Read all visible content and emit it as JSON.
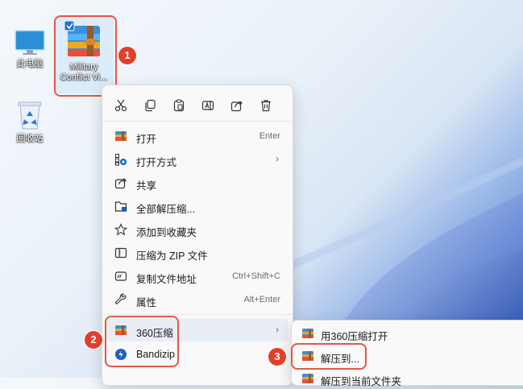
{
  "desktop": {
    "icons": [
      {
        "label": "此电脑"
      },
      {
        "label_line1": "Military",
        "label_line2": "Conflict Vi..."
      },
      {
        "label": "回收站"
      }
    ]
  },
  "steps": [
    "1",
    "2",
    "3"
  ],
  "context_menu": {
    "toolbar": [
      "cut-icon",
      "copy-icon",
      "paste-icon",
      "rename-icon",
      "share-icon",
      "delete-icon"
    ],
    "items": [
      {
        "label": "打开",
        "accel": "Enter",
        "icon": "archive-icon"
      },
      {
        "label": "打开方式",
        "submenu": true,
        "icon": "open-with-icon"
      },
      {
        "label": "共享",
        "icon": "share-icon"
      },
      {
        "label": "全部解压缩...",
        "icon": "extract-all-icon"
      },
      {
        "label": "添加到收藏夹",
        "icon": "star-icon"
      },
      {
        "label": "压缩为 ZIP 文件",
        "icon": "zip-icon"
      },
      {
        "label": "复制文件地址",
        "accel": "Ctrl+Shift+C",
        "icon": "copy-path-icon"
      },
      {
        "label": "属性",
        "accel": "Alt+Enter",
        "icon": "wrench-icon"
      },
      {
        "label": "360压缩",
        "submenu": true,
        "icon": "archive-icon"
      },
      {
        "label": "Bandizip",
        "icon": "bandizip-icon"
      }
    ],
    "chevron": "›"
  },
  "submenu": {
    "items": [
      {
        "label": "用360压缩打开"
      },
      {
        "label": "解压到..."
      },
      {
        "label": "解压到当前文件夹"
      }
    ]
  },
  "colors": {
    "highlight": "#e05a47",
    "badge": "#e0402b",
    "accent": "#0a64c8"
  }
}
